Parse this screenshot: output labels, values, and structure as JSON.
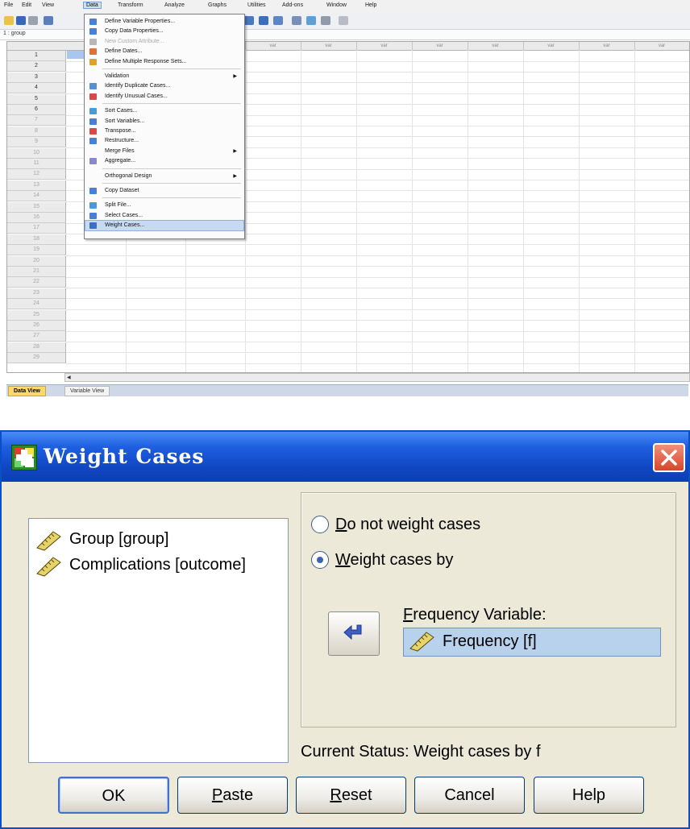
{
  "spss": {
    "menus": [
      "File",
      "Edit",
      "View",
      "Data",
      "Transform",
      "Analyze",
      "Graphs",
      "Utilities",
      "Add-ons",
      "Window",
      "Help"
    ],
    "active_menu": "Data",
    "cell_ref": "1 : group",
    "column_placeholder": "var",
    "rows": [
      "1",
      "2",
      "3",
      "4",
      "5",
      "6",
      "7",
      "8",
      "9",
      "10",
      "11",
      "12",
      "13",
      "14",
      "15",
      "16",
      "17",
      "18",
      "19",
      "20",
      "21",
      "22",
      "23",
      "24",
      "25",
      "26",
      "27",
      "28",
      "29"
    ],
    "tabs": {
      "data_view": "Data View",
      "variable_view": "Variable View"
    },
    "data_menu": {
      "items": [
        {
          "label": "Define Variable Properties...",
          "icon": "define-variable-icon",
          "color": "#4a7fd6"
        },
        {
          "label": "Copy Data Properties...",
          "icon": "copy-properties-icon",
          "color": "#4a7fd6"
        },
        {
          "label": "New Custom Attribute...",
          "icon": "custom-attribute-icon",
          "color": "#b6b6b6",
          "disabled": true
        },
        {
          "label": "Define Dates...",
          "icon": "calendar-icon",
          "color": "#e0703a"
        },
        {
          "label": "Define Multiple Response Sets...",
          "icon": "multiple-response-icon",
          "color": "#d9a42a"
        },
        {
          "separator": true
        },
        {
          "label": "Validation",
          "submenu": true
        },
        {
          "label": "Identify Duplicate Cases...",
          "icon": "duplicate-cases-icon",
          "color": "#5a8fd8"
        },
        {
          "label": "Identify Unusual Cases...",
          "icon": "unusual-cases-icon",
          "color": "#d84a4a"
        },
        {
          "separator": true
        },
        {
          "label": "Sort Cases...",
          "icon": "sort-cases-icon",
          "color": "#4a9ad8"
        },
        {
          "label": "Sort Variables...",
          "icon": "sort-variables-icon",
          "color": "#4a7fd6"
        },
        {
          "label": "Transpose...",
          "icon": "transpose-icon",
          "color": "#d84a4a"
        },
        {
          "label": "Restructure...",
          "icon": "restructure-icon",
          "color": "#4a7fd6"
        },
        {
          "label": "Merge Files",
          "submenu": true
        },
        {
          "label": "Aggregate...",
          "icon": "aggregate-icon",
          "color": "#8a8ac8"
        },
        {
          "separator": true
        },
        {
          "label": "Orthogonal Design",
          "submenu": true
        },
        {
          "separator": true
        },
        {
          "label": "Copy Dataset",
          "icon": "copy-dataset-icon",
          "color": "#4a7fd6"
        },
        {
          "separator": true
        },
        {
          "label": "Split File...",
          "icon": "split-file-icon",
          "color": "#4a9ad8"
        },
        {
          "label": "Select Cases...",
          "icon": "select-cases-icon",
          "color": "#4a7fd6"
        },
        {
          "label": "Weight Cases...",
          "icon": "weight-cases-icon",
          "color": "#3a6fc6",
          "highlighted": true
        }
      ]
    }
  },
  "dialog": {
    "title": "Weight Cases",
    "variables": [
      {
        "label": "Group [group]",
        "icon": "ruler-icon"
      },
      {
        "label": "Complications [outcome]",
        "icon": "ruler-icon"
      }
    ],
    "options": {
      "no_weight": {
        "mnemonic": "D",
        "rest": "o not weight cases",
        "selected": false
      },
      "weight_by": {
        "mnemonic": "W",
        "rest": "eight cases by",
        "selected": true
      }
    },
    "frequency_label": {
      "mnemonic": "F",
      "rest": "requency Variable:"
    },
    "frequency_value": "Frequency [f]",
    "status": "Current Status: Weight cases by f",
    "buttons": {
      "ok": "OK",
      "paste": {
        "mnemonic": "P",
        "rest": "aste"
      },
      "reset": {
        "mnemonic": "R",
        "rest": "eset"
      },
      "cancel": "Cancel",
      "help": "Help"
    },
    "colors": {
      "title_bar": "#1147c4",
      "selection": "#b8d2ee",
      "radio_dot": "#3d62b5"
    }
  }
}
